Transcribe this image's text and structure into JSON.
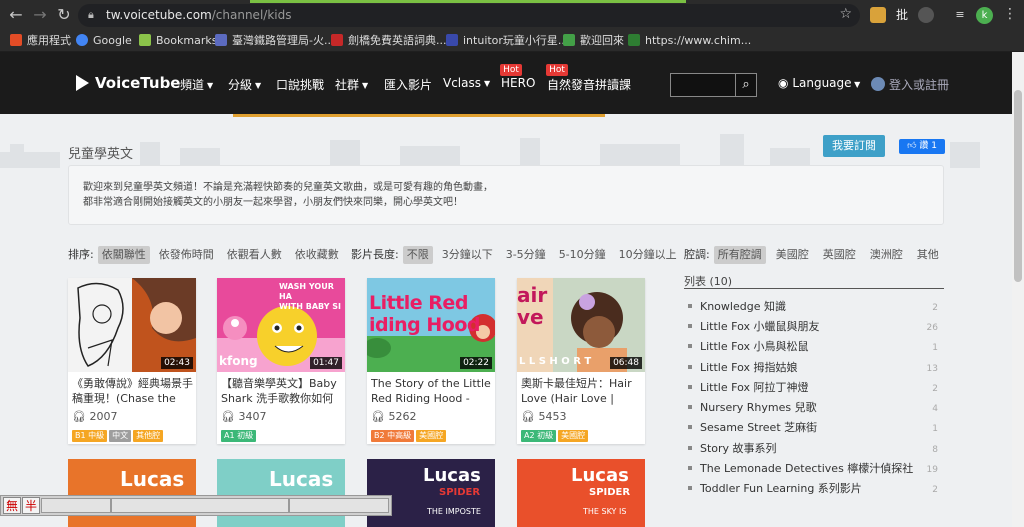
{
  "browser": {
    "url_host": "tw.voicetube.com",
    "url_path": "/channel/kids",
    "profile_initial": "k",
    "ext_labels": [
      "批"
    ]
  },
  "bookmarks": [
    {
      "label": "應用程式",
      "color": "#e34c26"
    },
    {
      "label": "Google",
      "color": "#4285f4"
    },
    {
      "label": "Bookmarks",
      "color": "#8bc34a"
    },
    {
      "label": "臺灣鐵路管理局-火...",
      "color": "#5c6bc0"
    },
    {
      "label": "劍橋免費英語詞典...",
      "color": "#c62828"
    },
    {
      "label": "intuitor玩童小行星...",
      "color": "#3949ab"
    },
    {
      "label": "歡迎回來",
      "color": "#43a047"
    },
    {
      "label": "https://www.chim...",
      "color": "#2e7d32"
    }
  ],
  "header": {
    "logo": "VoiceTube",
    "menu": [
      "頻道",
      "分級",
      "口說挑戰",
      "社群",
      "匯入影片",
      "Vclass",
      "HERO",
      "自然發音拼讀課"
    ],
    "hot_label": "Hot",
    "language": "Language",
    "login": "登入或註冊"
  },
  "channel": {
    "title": "兒童學英文",
    "subscribe": "我要訂閱",
    "like": "讚 1",
    "description_lines": [
      "歡迎來到兒童學英文頻道！不論是充滿輕快節奏的兒童英文歌曲，或是可愛有趣的角色動畫，",
      "都非常適合剛開始接觸英文的小朋友一起來學習，小朋友們快來同樂，開心學英文吧！"
    ]
  },
  "sort": {
    "label": "排序:",
    "options": [
      "依關聯性",
      "依發佈時間",
      "依觀看人數",
      "依收藏數"
    ]
  },
  "length": {
    "label": "影片長度:",
    "options": [
      "不限",
      "3分鐘以下",
      "3-5分鐘",
      "5-10分鐘",
      "10分鐘以上"
    ]
  },
  "accent": {
    "label": "腔調:",
    "options": [
      "所有腔調",
      "美國腔",
      "英國腔",
      "澳洲腔",
      "其他"
    ]
  },
  "videos": [
    {
      "duration": "02:43",
      "title": "《勇敢傳說》經典場景手稿重現！(Chase the Sky",
      "views": "2007",
      "tags": [
        {
          "t": "B1 中級",
          "c": "#f5a623"
        },
        {
          "t": "中文",
          "c": "#9e9e9e"
        },
        {
          "t": "其他腔",
          "c": "#f5a623"
        }
      ]
    },
    {
      "duration": "01:47",
      "title": "【聽音樂學英文】Baby Shark 洗手歌教你如何正",
      "views": "3407",
      "tags": [
        {
          "t": "A1 初級",
          "c": "#3cb878"
        }
      ]
    },
    {
      "duration": "02:22",
      "title": "The Story of the Little Red Riding Hood -",
      "views": "5262",
      "tags": [
        {
          "t": "B2 中高級",
          "c": "#f07a3a"
        },
        {
          "t": "美國腔",
          "c": "#f5a623"
        }
      ]
    },
    {
      "duration": "06:48",
      "title": "奧斯卡最佳短片：Hair Love (Hair Love |",
      "views": "5453",
      "tags": [
        {
          "t": "A2 初級",
          "c": "#3cb878"
        },
        {
          "t": "美國腔",
          "c": "#f5a623"
        }
      ]
    }
  ],
  "thumb_text": {
    "v2": [
      "WASH YOUR HA",
      "WITH BABY SI",
      "kfong"
    ],
    "v3": [
      "Little Red",
      "iding Hood"
    ],
    "v4": [
      "air",
      "ve",
      "L L   S H O R T"
    ],
    "b": [
      "Lucas",
      "SPIDER",
      "THE IMPOSTE",
      "THE SKY IS"
    ]
  },
  "list": {
    "heading": "列表 (10)",
    "items": [
      {
        "name": "Knowledge 知識",
        "count": "2"
      },
      {
        "name": "Little Fox 小蠟鼠與朋友",
        "count": "26"
      },
      {
        "name": "Little Fox 小鳥與松鼠",
        "count": "1"
      },
      {
        "name": "Little Fox 拇指姑娘",
        "count": "13"
      },
      {
        "name": "Little Fox 阿拉丁神燈",
        "count": "2"
      },
      {
        "name": "Nursery Rhymes 兒歌",
        "count": "4"
      },
      {
        "name": "Sesame Street 芝麻街",
        "count": "1"
      },
      {
        "name": "Story 故事系列",
        "count": "8"
      },
      {
        "name": "The Lemonade Detectives 檸檬汁偵探社",
        "count": "19"
      },
      {
        "name": "Toddler Fun Learning 系列影片",
        "count": "2"
      }
    ]
  },
  "ime": {
    "k1": "無",
    "k2": "半"
  }
}
